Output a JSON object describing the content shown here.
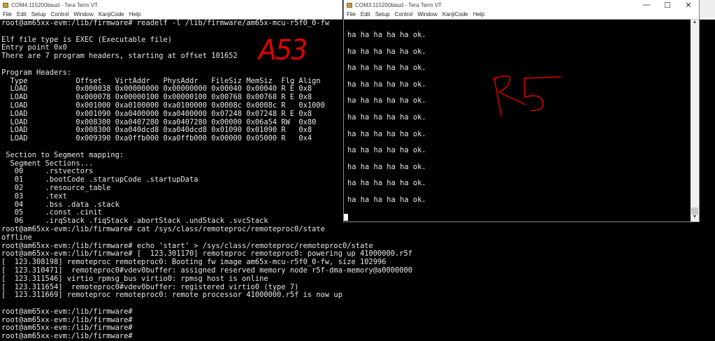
{
  "com4": {
    "title": "COM4:115200baud - Tera Term VT",
    "menu": [
      "File",
      "Edit",
      "Setup",
      "Control",
      "Window",
      "KanjiCode",
      "Help"
    ],
    "lines": [
      "root@am65xx-evm:/lib/firmware# readelf -l /lib/firmware/am65x-mcu-r5f0_0-fw",
      "",
      "Elf file type is EXEC (Executable file)",
      "Entry point 0x0",
      "There are 7 program headers, starting at offset 101652",
      "",
      "Program Headers:",
      "  Type           Offset   VirtAddr   PhysAddr   FileSiz MemSiz  Flg Align",
      "  LOAD           0x000038 0x00000000 0x00000000 0x00040 0x00040 R E 0x8",
      "  LOAD           0x000078 0x00000100 0x00000100 0x00768 0x00768 R E 0x8",
      "  LOAD           0x001000 0xa0100000 0xa0100000 0x0008c 0x0008c R   0x1000",
      "  LOAD           0x001090 0xa0400000 0xa0400000 0x07248 0x07248 R E 0x8",
      "  LOAD           0x008300 0xa0407280 0xa0407280 0x00000 0x06a54 RW  0x80",
      "  LOAD           0x008300 0xa040dcd8 0xa040dcd8 0x01090 0x01090 R   0x8",
      "  LOAD           0x009390 0xa0ffb000 0xa0ffb000 0x00000 0x05000 R   0x4",
      "",
      " Section to Segment mapping:",
      "  Segment Sections...",
      "   00     .rstvectors",
      "   01     .bootCode .startupCode .startupData",
      "   02     .resource_table",
      "   03     .text",
      "   04     .bss .data .stack",
      "   05     .const .cinit",
      "   06     .irqStack .fiqStack .abortStack .undStack .svcStack",
      "root@am65xx-evm:/lib/firmware# cat /sys/class/remoteproc/remoteproc0/state",
      "offline",
      "root@am65xx-evm:/lib/firmware# echo 'start' > /sys/class/remoteproc/remoteproc0/state",
      "root@am65xx-evm:/lib/firmware# [  123.301170] remoteproc remoteproc0: powering up 41000000.r5f",
      "[  123.308198] remoteproc remoteproc0: Booting fw image am65x-mcu-r5f0_0-fw, size 102996",
      "[  123.310471]  remoteproc0#vdev0buffer: assigned reserved memory node r5f-dma-memory@a0000000",
      "[  123.311546] virtio_rpmsg_bus virtio0: rpmsg host is online",
      "[  123.311654]  remoteproc0#vdev0buffer: registered virtio0 (type 7)",
      "[  123.311669] remoteproc remoteproc0: remote processor 41000000.r5f is now up",
      "",
      "root@am65xx-evm:/lib/firmware#",
      "root@am65xx-evm:/lib/firmware#",
      "root@am65xx-evm:/lib/firmware#",
      "root@am65xx-evm:/lib/firmware#"
    ],
    "annotation": "A53"
  },
  "com3": {
    "title": "COM3:115200baud - Tera Term VT",
    "menu": [
      "File",
      "Edit",
      "Setup",
      "Control",
      "Window",
      "KanjiCode",
      "Help"
    ],
    "buttons": {
      "minimize": "—",
      "maximize": "☐",
      "close": "✕"
    },
    "lines": [
      "ha ha ha ha ha ok.",
      "ha ha ha ha ha ok.",
      "ha ha ha ha ha ok.",
      "ha ha ha ha ha ok.",
      "ha ha ha ha ha ok.",
      "ha ha ha ha ha ok.",
      "ha ha ha ha ha ok.",
      "ha ha ha ha ha ok.",
      "ha ha ha ha ha ok.",
      "ha ha ha ha ha ok.",
      "ha ha ha ha ha ok."
    ],
    "annotation": "R5",
    "ink_color": "#e00000"
  }
}
